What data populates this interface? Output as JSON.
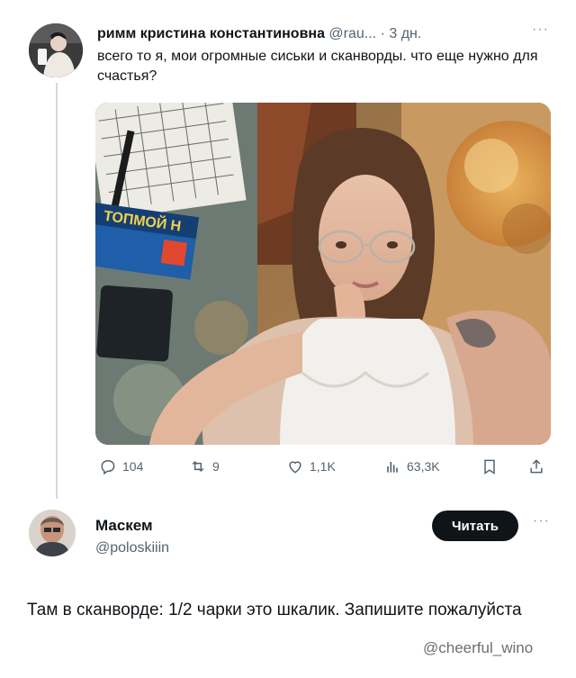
{
  "tweet": {
    "author_name": "римм кристина константиновна",
    "handle": "@rau...",
    "separator": " · ",
    "time": "3 дн.",
    "more_label": "···",
    "text": "всего то я, мои огромные сиськи и сканворды. что еще нужно для счастья?",
    "media_text": "ТОПМОЙ Н",
    "actions": {
      "replies": "104",
      "reposts": "9",
      "likes": "1,1K",
      "views": "63,3K"
    }
  },
  "reply": {
    "author_name": "Маскем",
    "handle": "@poloskiiin",
    "read_button": "Читать",
    "more_label": "···",
    "text": "Там в сканворде: 1/2 чарки это шкалик. Запишите пожалуйста"
  },
  "watermark": "@cheerful_wino",
  "icons": [
    "reply-icon",
    "repost-icon",
    "like-icon",
    "views-icon",
    "bookmark-icon",
    "share-icon"
  ],
  "colors": {
    "accent_dark": "#0f1419",
    "muted": "#536471",
    "line": "#cfd9de"
  }
}
